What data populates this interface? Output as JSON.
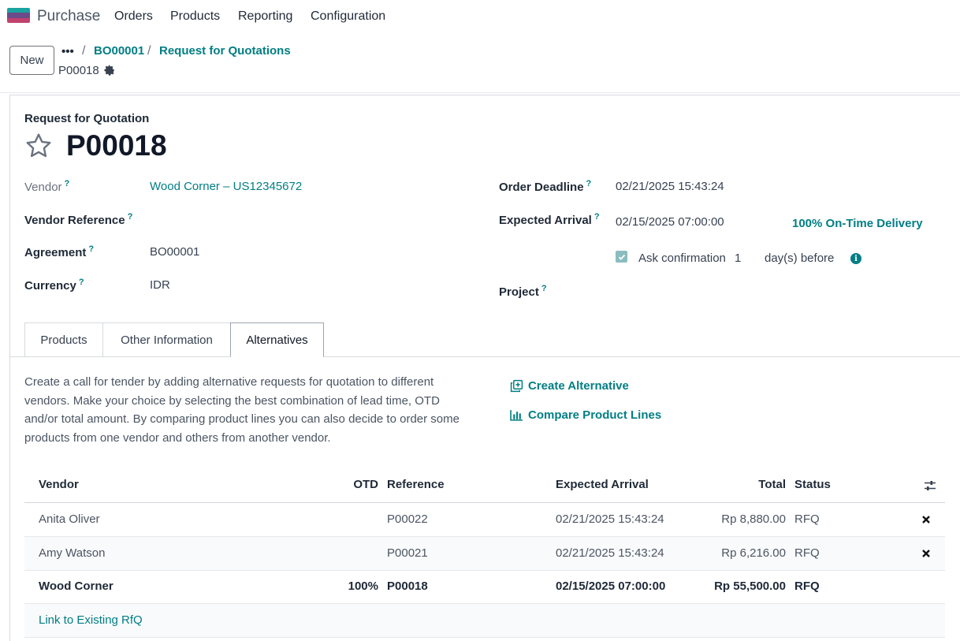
{
  "app": {
    "name": "Purchase",
    "menu": [
      "Orders",
      "Products",
      "Reporting",
      "Configuration"
    ]
  },
  "control_panel": {
    "new_label": "New",
    "more_label": "•••",
    "breadcrumbs": [
      "BO00001",
      "Request for Quotations"
    ],
    "current": "P00018"
  },
  "form": {
    "title_label": "Request for Quotation",
    "number": "P00018",
    "fields": {
      "vendor_label": "Vendor",
      "vendor_value": "Wood Corner – US12345672",
      "vendor_ref_label": "Vendor Reference",
      "agreement_label": "Agreement",
      "agreement_value": "BO00001",
      "currency_label": "Currency",
      "currency_value": "IDR",
      "order_deadline_label": "Order Deadline",
      "order_deadline_value": "02/21/2025 15:43:24",
      "expected_arrival_label": "Expected Arrival",
      "expected_arrival_value": "02/15/2025 07:00:00",
      "on_time_delivery": "100% On-Time Delivery",
      "ask_confirmation_label": "Ask confirmation",
      "ask_confirmation_days": "1",
      "ask_confirmation_suffix": "day(s) before",
      "project_label": "Project",
      "help_mark": "?"
    },
    "tabs": [
      "Products",
      "Other Information",
      "Alternatives"
    ],
    "active_tab": "Alternatives"
  },
  "alternatives": {
    "help_text": "Create a call for tender by adding alternative requests for quotation to different vendors. Make your choice by selecting the best combination of lead time, OTD and/or total amount. By comparing product lines you can also decide to order some products from one vendor and others from another vendor.",
    "create_alternative": "Create Alternative",
    "compare_lines": "Compare Product Lines",
    "columns": {
      "vendor": "Vendor",
      "otd": "OTD",
      "reference": "Reference",
      "expected_arrival": "Expected Arrival",
      "total": "Total",
      "status": "Status"
    },
    "rows": [
      {
        "vendor": "Anita Oliver",
        "otd": "",
        "reference": "P00022",
        "expected_arrival": "02/21/2025 15:43:24",
        "total": "Rp 8,880.00",
        "status": "RFQ"
      },
      {
        "vendor": "Amy Watson",
        "otd": "",
        "reference": "P00021",
        "expected_arrival": "02/21/2025 15:43:24",
        "total": "Rp 6,216.00",
        "status": "RFQ"
      },
      {
        "vendor": "Wood Corner",
        "otd": "100%",
        "reference": "P00018",
        "expected_arrival": "02/15/2025 07:00:00",
        "total": "Rp 55,500.00",
        "status": "RFQ"
      }
    ],
    "link_existing": "Link to Existing RfQ"
  },
  "colors": {
    "accent": "#017e84",
    "brand": "#714b67"
  }
}
